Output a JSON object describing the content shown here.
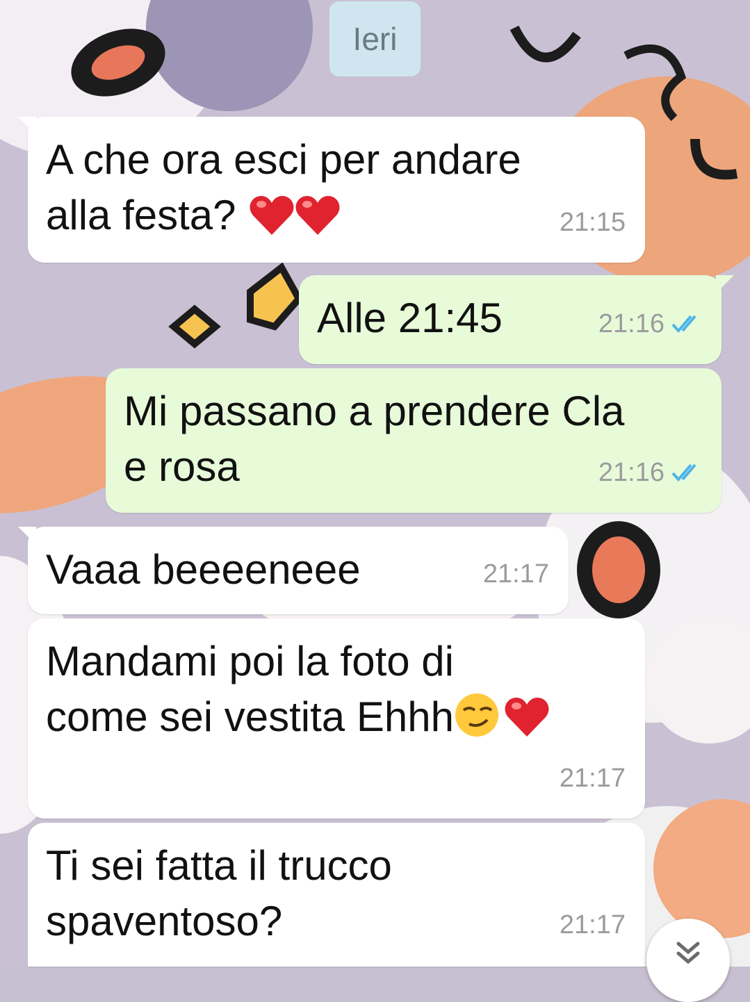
{
  "date_chip": "Ieri",
  "messages": [
    {
      "direction": "in",
      "text": "A che ora esci per andare\nalla festa?",
      "emojis": [
        "heart",
        "heart"
      ],
      "time": "21:15"
    },
    {
      "direction": "out",
      "text": "Alle 21:45",
      "time": "21:16",
      "status": "read"
    },
    {
      "direction": "out",
      "text": "Mi passano a prendere Cla\ne rosa",
      "time": "21:16",
      "status": "read"
    },
    {
      "direction": "in",
      "text": "Vaaa beeeeneee",
      "time": "21:17"
    },
    {
      "direction": "in",
      "text": "Mandami poi la foto di\ncome sei vestita Ehhh",
      "emojis": [
        "smirking-face",
        "heart"
      ],
      "time": "21:17"
    },
    {
      "direction": "in",
      "text": "Ti sei fatta il trucco\nspaventoso?",
      "time": "21:17"
    }
  ],
  "colors": {
    "incoming_bubble": "#ffffff",
    "outgoing_bubble": "#e7fbd9",
    "read_ticks": "#4fb3ea",
    "date_chip": "#cfe6f1"
  },
  "icons": {
    "scroll_down": "double-chevron-down-icon",
    "read_status": "double-check-icon"
  }
}
